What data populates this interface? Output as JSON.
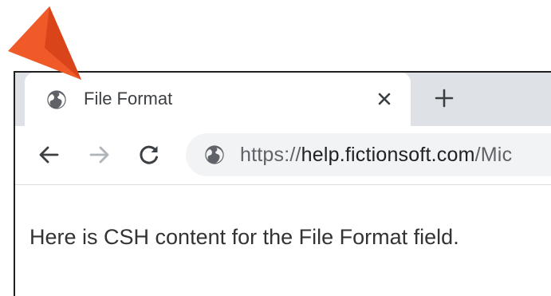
{
  "tab": {
    "title": "File Format",
    "globe_icon": "globe-icon",
    "close_icon": "close-icon"
  },
  "new_tab_icon": "plus-icon",
  "toolbar": {
    "back_icon": "back-arrow-icon",
    "forward_icon": "forward-arrow-icon",
    "reload_icon": "reload-icon"
  },
  "address_bar": {
    "scheme": "https://",
    "host": "help.fictionsoft.com",
    "rest": "/Mic"
  },
  "content": {
    "text": "Here is CSH content for the File Format field."
  },
  "pointer_icon": "orange-pointer-arrow-icon",
  "colors": {
    "pointer": "#f05a28",
    "tabstrip": "#dee1e6",
    "omnibox": "#f1f3f4"
  }
}
